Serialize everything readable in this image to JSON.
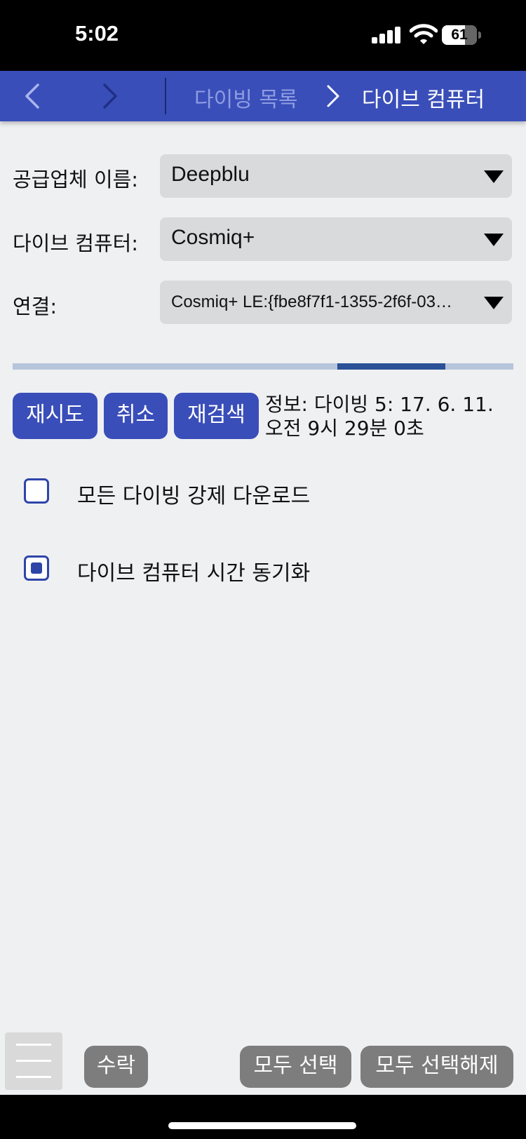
{
  "status_bar": {
    "time": "5:02",
    "battery": "61",
    "battery_level": 0.61
  },
  "nav": {
    "breadcrumb_prev": "다이빙 목록",
    "breadcrumb_current": "다이브 컴퓨터",
    "colors": {
      "bar": "#3a4eb9",
      "active": "#ffffff",
      "inactive": "#8e9de2"
    }
  },
  "form": {
    "vendor_label": "공급업체 이름:",
    "vendor_value": "Deepblu",
    "computer_label": "다이브 컴퓨터:",
    "computer_value": "Cosmiq+",
    "connection_label": "연결:",
    "connection_value": "Cosmiq+ LE:{fbe8f7f1-1355-2f6f-03…"
  },
  "progress": {
    "start_fraction": 0.648,
    "end_fraction": 0.864
  },
  "actions": {
    "retry": "재시도",
    "cancel": "취소",
    "rescan": "재검색"
  },
  "info": {
    "line1": "정보: 다이빙 5: 17. 6. 11.",
    "line2": "오전 9시 29분 0초"
  },
  "options": {
    "force_download": {
      "label": "모든 다이빙 강제 다운로드",
      "checked": false
    },
    "sync_time": {
      "label": "다이브 컴퓨터 시간 동기화",
      "checked": true
    }
  },
  "bottom_bar": {
    "accept": "수락",
    "select_all": "모두 선택",
    "deselect_all": "모두 선택해제"
  }
}
